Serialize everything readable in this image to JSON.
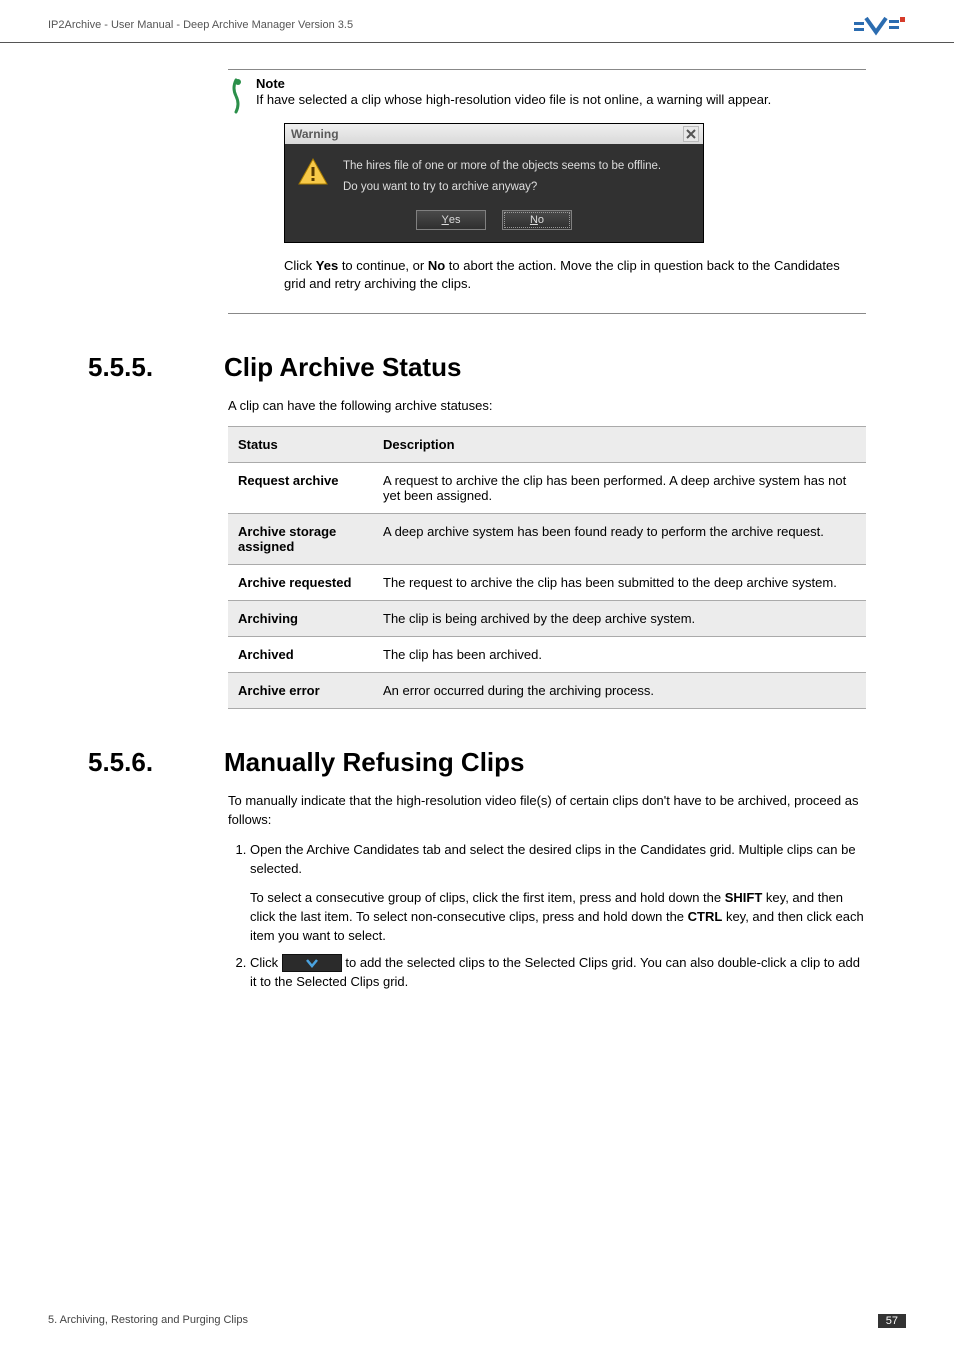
{
  "header": {
    "title": "IP2Archive - User Manual - Deep Archive Manager Version 3.5"
  },
  "note": {
    "label": "Note",
    "text": "If have selected a clip whose high-resolution video file is not online, a warning will appear."
  },
  "warning_dialog": {
    "title": "Warning",
    "line1": "The hires file of one or more of the objects seems to be offline.",
    "line2": "Do you want to try to archive anyway?",
    "yes": "Yes",
    "no": "No"
  },
  "note_continue": {
    "pre": "Click ",
    "yes": "Yes",
    "mid1": " to continue, or ",
    "no": "No",
    "mid2": " to abort the action. Move the clip in question back to the Candidates grid and retry archiving the clips."
  },
  "section_555": {
    "num": "5.5.5.",
    "title": "Clip Archive Status",
    "intro": "A clip can have the following archive statuses:",
    "table": {
      "headers": [
        "Status",
        "Description"
      ],
      "rows": [
        [
          "Request archive",
          "A request to archive the clip has been performed. A deep archive system has not yet been assigned."
        ],
        [
          "Archive storage assigned",
          "A deep archive system has been found ready to perform the archive request."
        ],
        [
          "Archive requested",
          "The request to archive the clip has been submitted to the deep archive system."
        ],
        [
          "Archiving",
          "The clip is being archived by the deep archive system."
        ],
        [
          "Archived",
          "The clip has been archived."
        ],
        [
          "Archive error",
          "An error occurred during the archiving process."
        ]
      ]
    }
  },
  "section_556": {
    "num": "5.5.6.",
    "title": "Manually Refusing Clips",
    "intro": "To manually indicate that the high-resolution video file(s) of certain clips don't have to be archived, proceed as follows:",
    "step1": "Open the Archive Candidates tab and select the desired clips in the Candidates grid. Multiple clips can be selected.",
    "step1_sub_pre": "To select a consecutive group of clips, click the first item, press and hold down the ",
    "shift": "SHIFT",
    "step1_sub_mid": " key, and then click the last item. To select non-consecutive clips, press and hold down the ",
    "ctrl": "CTRL",
    "step1_sub_post": " key, and then click each item you want to select.",
    "step2_pre": "Click ",
    "step2_post": " to add the selected clips to the Selected Clips grid. You can also double-click a clip to add it to the Selected Clips grid."
  },
  "footer": {
    "left": "5. Archiving, Restoring and Purging Clips",
    "page": "57"
  }
}
